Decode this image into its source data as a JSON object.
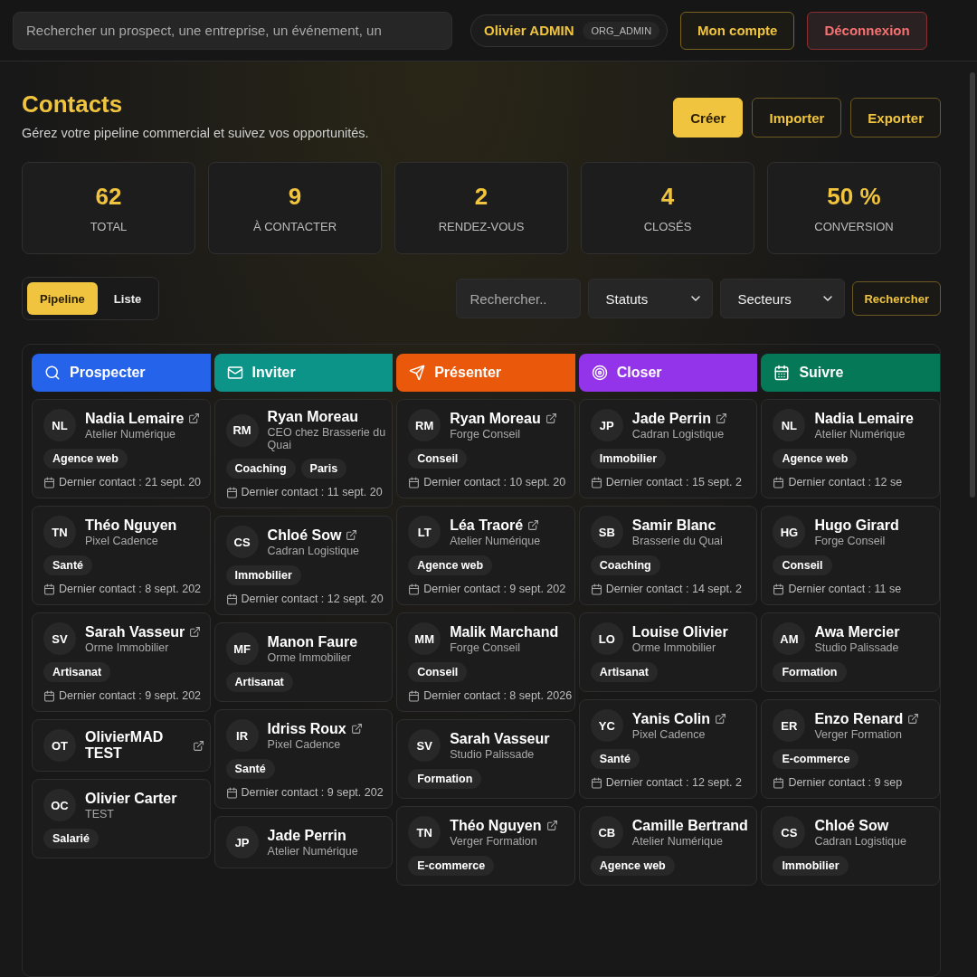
{
  "topbar": {
    "search": {
      "placeholder": "Rechercher un prospect, une entreprise, un événement, un"
    },
    "user": {
      "name": "Olivier ADMIN",
      "role": "ORG_ADMIN"
    },
    "buttons": [
      {
        "label": "Mon compte",
        "kind": "account"
      },
      {
        "label": "Déconnexion",
        "kind": "danger"
      }
    ]
  },
  "header": {
    "title": "Contacts",
    "subtitle": "Gérez votre pipeline commercial et suivez vos opportunités.",
    "actions": [
      {
        "label": "Créer",
        "kind": "primary"
      },
      {
        "label": "Importer",
        "kind": "outline"
      },
      {
        "label": "Exporter",
        "kind": "outline"
      }
    ]
  },
  "stats": [
    {
      "value": "62",
      "label": "TOTAL"
    },
    {
      "value": "9",
      "label": "À CONTACTER"
    },
    {
      "value": "2",
      "label": "RENDEZ-VOUS"
    },
    {
      "value": "4",
      "label": "CLOSÉS"
    },
    {
      "value": "50 %",
      "label": "CONVERSION"
    }
  ],
  "toolbar": {
    "views": [
      {
        "label": "Pipeline",
        "selected": true
      },
      {
        "label": "Liste",
        "selected": false
      }
    ],
    "search": {
      "placeholder": "Rechercher.."
    },
    "filters": [
      "Statuts",
      "Secteurs"
    ],
    "button": "Rechercher"
  },
  "columns": [
    {
      "title": "Prospecter",
      "color": "#2563eb",
      "cards": [
        {
          "initials": "NL",
          "name": "Nadia Lemaire",
          "company": "Atelier Numérique",
          "link": true,
          "tags": [
            "Agence web"
          ],
          "date": "Dernier contact : 21 sept. 20"
        },
        {
          "initials": "TN",
          "name": "Théo Nguyen",
          "company": "Pixel Cadence",
          "link": false,
          "tags": [
            "Santé"
          ],
          "date": "Dernier contact : 8 sept. 202"
        },
        {
          "initials": "SV",
          "name": "Sarah Vasseur",
          "company": "Orme Immobilier",
          "link": true,
          "tags": [
            "Artisanat"
          ],
          "date": "Dernier contact : 9 sept. 202"
        },
        {
          "initials": "OT",
          "name": "OlivierMAD TEST",
          "link": true
        },
        {
          "initials": "OC",
          "name": "Olivier Carter",
          "company": "TEST",
          "link": false,
          "tags": [
            "Salarié"
          ]
        }
      ]
    },
    {
      "title": "Inviter",
      "color": "#0d9488",
      "cards": [
        {
          "initials": "RM",
          "name": "Ryan Moreau",
          "company": "CEO chez Brasserie du Quai",
          "link": false,
          "tags": [
            "Coaching",
            "Paris"
          ],
          "date": "Dernier contact : 11 sept. 20"
        },
        {
          "initials": "CS",
          "name": "Chloé Sow",
          "company": "Cadran Logistique",
          "link": true,
          "tags": [
            "Immobilier"
          ],
          "date": "Dernier contact : 12 sept. 20"
        },
        {
          "initials": "MF",
          "name": "Manon Faure",
          "company": "Orme Immobilier",
          "link": false,
          "tags": [
            "Artisanat"
          ]
        },
        {
          "initials": "IR",
          "name": "Idriss Roux",
          "company": "Pixel Cadence",
          "link": true,
          "tags": [
            "Santé"
          ],
          "date": "Dernier contact : 9 sept. 202"
        },
        {
          "initials": "JP",
          "name": "Jade Perrin",
          "company": "Atelier Numérique",
          "link": false
        }
      ]
    },
    {
      "title": "Présenter",
      "color": "#ea580c",
      "cards": [
        {
          "initials": "RM",
          "name": "Ryan Moreau",
          "company": "Forge Conseil",
          "link": true,
          "tags": [
            "Conseil"
          ],
          "date": "Dernier contact : 10 sept. 20"
        },
        {
          "initials": "LT",
          "name": "Léa Traoré",
          "company": "Atelier Numérique",
          "link": true,
          "tags": [
            "Agence web"
          ],
          "date": "Dernier contact : 9 sept. 202"
        },
        {
          "initials": "MM",
          "name": "Malik Marchand",
          "company": "Forge Conseil",
          "link": false,
          "tags": [
            "Conseil"
          ],
          "date": "Dernier contact : 8 sept. 2026"
        },
        {
          "initials": "SV",
          "name": "Sarah Vasseur",
          "company": "Studio Palissade",
          "link": false,
          "tags": [
            "Formation"
          ]
        },
        {
          "initials": "TN",
          "name": "Théo Nguyen",
          "company": "Verger Formation",
          "link": true,
          "tags": [
            "E-commerce"
          ]
        }
      ]
    },
    {
      "title": "Closer",
      "color": "#9333ea",
      "cards": [
        {
          "initials": "JP",
          "name": "Jade Perrin",
          "company": "Cadran Logistique",
          "link": true,
          "tags": [
            "Immobilier"
          ],
          "date": "Dernier contact : 15 sept. 2"
        },
        {
          "initials": "SB",
          "name": "Samir Blanc",
          "company": "Brasserie du Quai",
          "link": false,
          "tags": [
            "Coaching"
          ],
          "date": "Dernier contact : 14 sept. 2"
        },
        {
          "initials": "LO",
          "name": "Louise Olivier",
          "company": "Orme Immobilier",
          "link": false,
          "tags": [
            "Artisanat"
          ]
        },
        {
          "initials": "YC",
          "name": "Yanis Colin",
          "company": "Pixel Cadence",
          "link": true,
          "tags": [
            "Santé"
          ],
          "date": "Dernier contact : 12 sept. 2"
        },
        {
          "initials": "CB",
          "name": "Camille Bertrand",
          "company": "Atelier Numérique",
          "link": false,
          "tags": [
            "Agence web"
          ]
        }
      ]
    },
    {
      "title": "Suivre",
      "color": "#047857",
      "cards": [
        {
          "initials": "NL",
          "name": "Nadia Lemaire",
          "company": "Atelier Numérique",
          "link": false,
          "tags": [
            "Agence web"
          ],
          "date": "Dernier contact : 12 se"
        },
        {
          "initials": "HG",
          "name": "Hugo Girard",
          "company": "Forge Conseil",
          "link": false,
          "tags": [
            "Conseil"
          ],
          "date": "Dernier contact : 11 se"
        },
        {
          "initials": "AM",
          "name": "Awa Mercier",
          "company": "Studio Palissade",
          "link": false,
          "tags": [
            "Formation"
          ]
        },
        {
          "initials": "ER",
          "name": "Enzo Renard",
          "company": "Verger Formation",
          "link": true,
          "tags": [
            "E-commerce"
          ],
          "date": "Dernier contact : 9 sep"
        },
        {
          "initials": "CS",
          "name": "Chloé Sow",
          "company": "Cadran Logistique",
          "link": false,
          "tags": [
            "Immobilier"
          ]
        }
      ]
    }
  ]
}
